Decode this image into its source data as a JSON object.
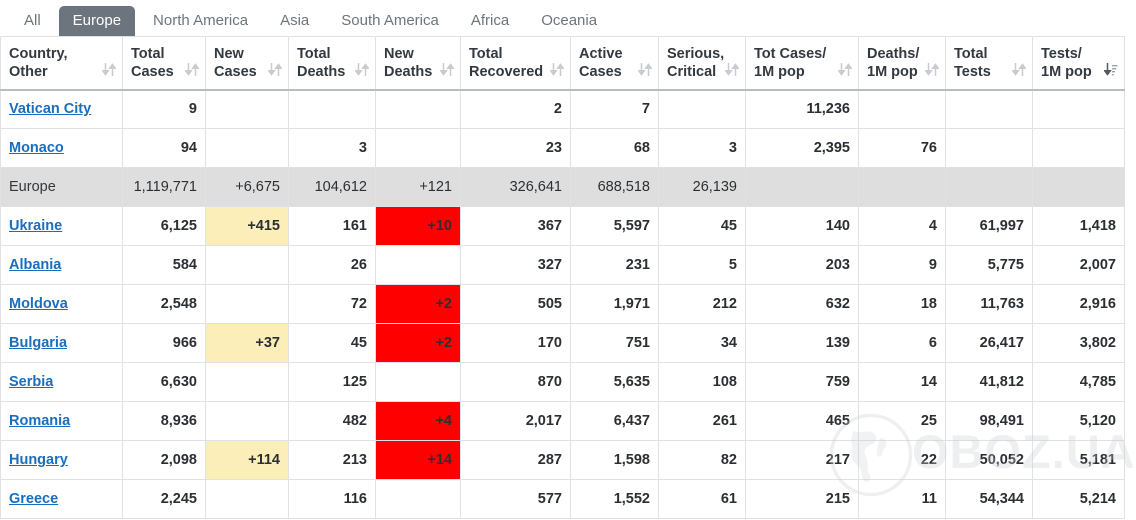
{
  "tabs": [
    {
      "label": "All",
      "active": false
    },
    {
      "label": "Europe",
      "active": true
    },
    {
      "label": "North America",
      "active": false
    },
    {
      "label": "Asia",
      "active": false
    },
    {
      "label": "South America",
      "active": false
    },
    {
      "label": "Africa",
      "active": false
    },
    {
      "label": "Oceania",
      "active": false
    }
  ],
  "watermark": {
    "text": "OBOZ.UA",
    "icon": "globe-icon"
  },
  "table": {
    "columns": [
      {
        "line1": "Country,",
        "line2": "Other",
        "sort": "inactive"
      },
      {
        "line1": "Total",
        "line2": "Cases",
        "sort": "inactive"
      },
      {
        "line1": "New",
        "line2": "Cases",
        "sort": "inactive"
      },
      {
        "line1": "Total",
        "line2": "Deaths",
        "sort": "inactive"
      },
      {
        "line1": "New",
        "line2": "Deaths",
        "sort": "inactive"
      },
      {
        "line1": "Total",
        "line2": "Recovered",
        "sort": "inactive"
      },
      {
        "line1": "Active",
        "line2": "Cases",
        "sort": "inactive"
      },
      {
        "line1": "Serious,",
        "line2": "Critical",
        "sort": "inactive"
      },
      {
        "line1": "Tot Cases/",
        "line2": "1M pop",
        "sort": "inactive"
      },
      {
        "line1": "Deaths/",
        "line2": "1M pop",
        "sort": "inactive"
      },
      {
        "line1": "Total",
        "line2": "Tests",
        "sort": "inactive"
      },
      {
        "line1": "Tests/",
        "line2": "1M pop",
        "sort": "desc"
      }
    ],
    "rows": [
      {
        "type": "country",
        "country": "Vatican City",
        "total_cases": "9",
        "new_cases": "",
        "total_deaths": "",
        "new_deaths": "",
        "total_recovered": "2",
        "active_cases": "7",
        "serious_critical": "",
        "tot_cases_1m": "11,236",
        "deaths_1m": "",
        "total_tests": "",
        "tests_1m": ""
      },
      {
        "type": "country",
        "country": "Monaco",
        "total_cases": "94",
        "new_cases": "",
        "total_deaths": "3",
        "new_deaths": "",
        "total_recovered": "23",
        "active_cases": "68",
        "serious_critical": "3",
        "tot_cases_1m": "2,395",
        "deaths_1m": "76",
        "total_tests": "",
        "tests_1m": ""
      },
      {
        "type": "aggregate",
        "country": "Europe",
        "total_cases": "1,119,771",
        "new_cases": "+6,675",
        "total_deaths": "104,612",
        "new_deaths": "+121",
        "total_recovered": "326,641",
        "active_cases": "688,518",
        "serious_critical": "26,139",
        "tot_cases_1m": "",
        "deaths_1m": "",
        "total_tests": "",
        "tests_1m": ""
      },
      {
        "type": "country",
        "country": "Ukraine",
        "total_cases": "6,125",
        "new_cases": "+415",
        "total_deaths": "161",
        "new_deaths": "+10",
        "total_recovered": "367",
        "active_cases": "5,597",
        "serious_critical": "45",
        "tot_cases_1m": "140",
        "deaths_1m": "4",
        "total_tests": "61,997",
        "tests_1m": "1,418"
      },
      {
        "type": "country",
        "country": "Albania",
        "total_cases": "584",
        "new_cases": "",
        "total_deaths": "26",
        "new_deaths": "",
        "total_recovered": "327",
        "active_cases": "231",
        "serious_critical": "5",
        "tot_cases_1m": "203",
        "deaths_1m": "9",
        "total_tests": "5,775",
        "tests_1m": "2,007"
      },
      {
        "type": "country",
        "country": "Moldova",
        "total_cases": "2,548",
        "new_cases": "",
        "total_deaths": "72",
        "new_deaths": "+2",
        "total_recovered": "505",
        "active_cases": "1,971",
        "serious_critical": "212",
        "tot_cases_1m": "632",
        "deaths_1m": "18",
        "total_tests": "11,763",
        "tests_1m": "2,916"
      },
      {
        "type": "country",
        "country": "Bulgaria",
        "total_cases": "966",
        "new_cases": "+37",
        "total_deaths": "45",
        "new_deaths": "+2",
        "total_recovered": "170",
        "active_cases": "751",
        "serious_critical": "34",
        "tot_cases_1m": "139",
        "deaths_1m": "6",
        "total_tests": "26,417",
        "tests_1m": "3,802"
      },
      {
        "type": "country",
        "country": "Serbia",
        "total_cases": "6,630",
        "new_cases": "",
        "total_deaths": "125",
        "new_deaths": "",
        "total_recovered": "870",
        "active_cases": "5,635",
        "serious_critical": "108",
        "tot_cases_1m": "759",
        "deaths_1m": "14",
        "total_tests": "41,812",
        "tests_1m": "4,785"
      },
      {
        "type": "country",
        "country": "Romania",
        "total_cases": "8,936",
        "new_cases": "",
        "total_deaths": "482",
        "new_deaths": "+4",
        "total_recovered": "2,017",
        "active_cases": "6,437",
        "serious_critical": "261",
        "tot_cases_1m": "465",
        "deaths_1m": "25",
        "total_tests": "98,491",
        "tests_1m": "5,120"
      },
      {
        "type": "country",
        "country": "Hungary",
        "total_cases": "2,098",
        "new_cases": "+114",
        "total_deaths": "213",
        "new_deaths": "+14",
        "total_recovered": "287",
        "active_cases": "1,598",
        "serious_critical": "82",
        "tot_cases_1m": "217",
        "deaths_1m": "22",
        "total_tests": "50,052",
        "tests_1m": "5,181"
      },
      {
        "type": "country",
        "country": "Greece",
        "total_cases": "2,245",
        "new_cases": "",
        "total_deaths": "116",
        "new_deaths": "",
        "total_recovered": "577",
        "active_cases": "1,552",
        "serious_critical": "61",
        "tot_cases_1m": "215",
        "deaths_1m": "11",
        "total_tests": "54,344",
        "tests_1m": "5,214"
      }
    ]
  },
  "colors": {
    "tab_active_bg": "#6c757d",
    "tab_text": "#6c757d",
    "link": "#1a6ebd",
    "new_cases_highlight": "#fbeeb8",
    "new_deaths_highlight": "#fe0000",
    "aggregate_row_bg": "#dedede",
    "border": "#dee2e6"
  }
}
